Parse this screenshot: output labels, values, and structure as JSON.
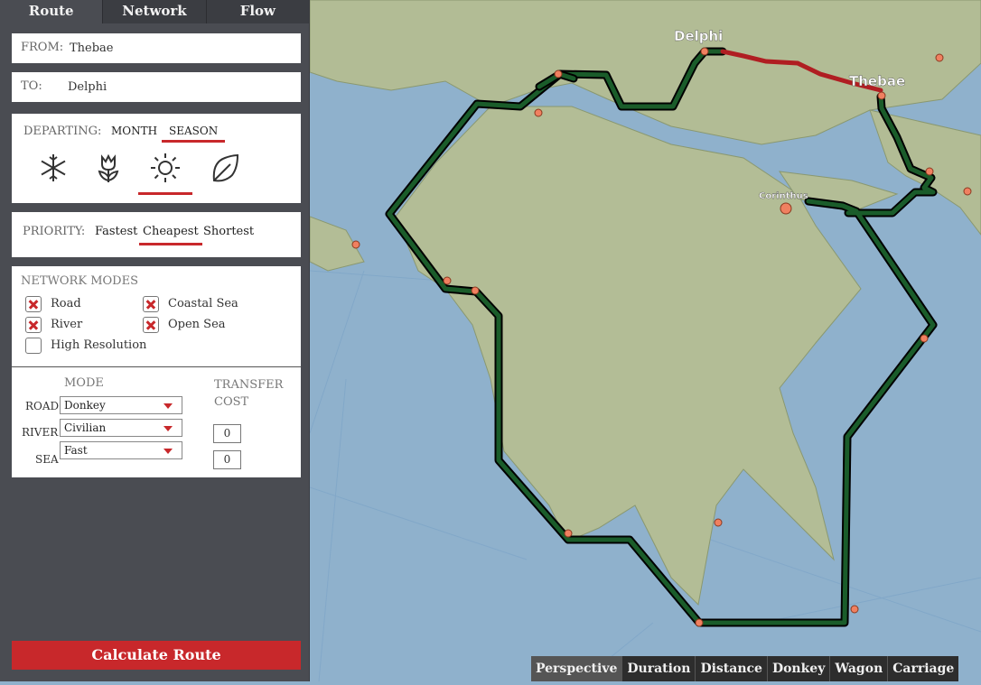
{
  "tabs": [
    "Route",
    "Network",
    "Flow"
  ],
  "route": {
    "from_label": "FROM:",
    "from_value": "Thebae",
    "to_label": "TO:",
    "to_value": "Delphi"
  },
  "departing": {
    "label": "DEPARTING:",
    "options": [
      "MONTH",
      "SEASON"
    ],
    "selected_option": "SEASON",
    "seasons": [
      "winter-snowflake-icon",
      "spring-tulip-icon",
      "summer-sun-icon",
      "autumn-leaf-icon"
    ],
    "selected_season": "summer"
  },
  "priority": {
    "label": "PRIORITY:",
    "options": [
      "Fastest",
      "Cheapest",
      "Shortest"
    ],
    "selected": "Cheapest"
  },
  "network_modes": {
    "title": "NETWORK MODES",
    "modes": [
      {
        "label": "Road",
        "checked": true
      },
      {
        "label": "Coastal Sea",
        "checked": true
      },
      {
        "label": "River",
        "checked": true
      },
      {
        "label": "Open Sea",
        "checked": true
      },
      {
        "label": "High Resolution",
        "checked": false
      }
    ]
  },
  "mode_table": {
    "mode_header": "MODE",
    "transfer_header": "TRANSFER COST",
    "rows": [
      {
        "label": "ROAD",
        "mode": "Donkey"
      },
      {
        "label": "RIVER",
        "mode": "Civilian"
      },
      {
        "label": "SEA",
        "mode": "Fast"
      }
    ],
    "transfer_costs": [
      "0",
      "0"
    ]
  },
  "calculate_label": "Calculate Route",
  "map": {
    "place_labels": [
      "Delphi",
      "Thebae",
      "Corinthus"
    ],
    "route_colors": {
      "sea": "#1a5c2a",
      "road": "#b01e22"
    }
  },
  "metrics": {
    "items": [
      "Perspective",
      "Duration",
      "Distance",
      "Donkey",
      "Wagon",
      "Carriage"
    ],
    "selected": "Perspective"
  }
}
